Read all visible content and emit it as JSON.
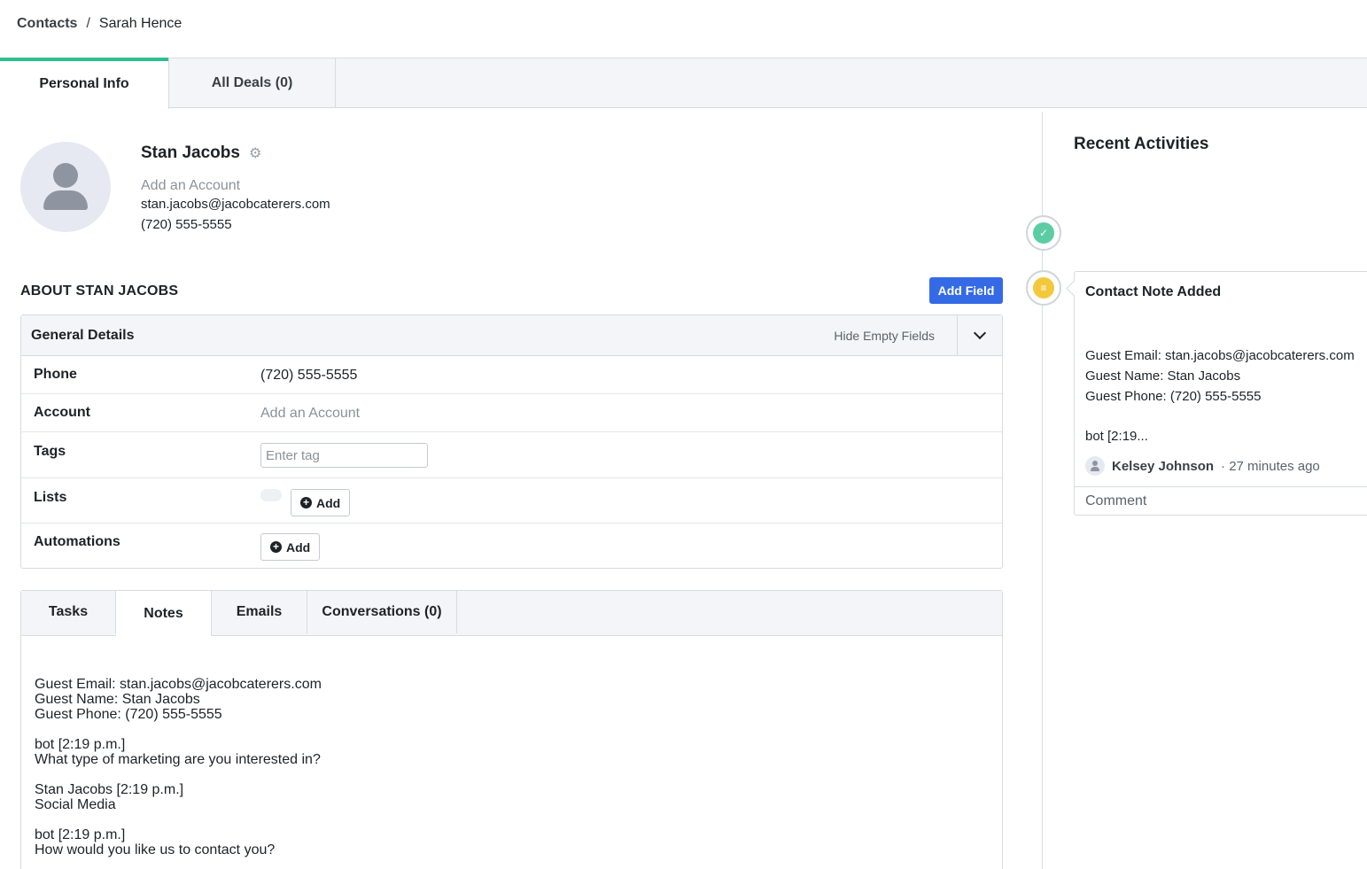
{
  "breadcrumb": {
    "parent": "Contacts",
    "separator": "/",
    "current": "Sarah Hence"
  },
  "top_tabs": {
    "personal": "Personal Info",
    "deals": "All Deals (0)"
  },
  "contact": {
    "name": "Stan Jacobs",
    "add_account": "Add an Account",
    "email": "stan.jacobs@jacobcaterers.com",
    "phone": "(720) 555-5555"
  },
  "about": {
    "title": "ABOUT STAN JACOBS",
    "add_field_label": "Add Field"
  },
  "general_details": {
    "title": "General Details",
    "hide_empty": "Hide Empty Fields",
    "phone_label": "Phone",
    "phone_value": "(720) 555-5555",
    "account_label": "Account",
    "account_value": "Add an Account",
    "tags_label": "Tags",
    "tags_placeholder": "Enter tag",
    "lists_label": "Lists",
    "lists_add": "Add",
    "automations_label": "Automations",
    "automations_add": "Add"
  },
  "activity_tabs": {
    "tasks": "Tasks",
    "notes": "Notes",
    "emails": "Emails",
    "conversations": "Conversations (0)"
  },
  "note": {
    "l1": "Guest Email: stan.jacobs@jacobcaterers.com",
    "l2": "Guest Name: Stan Jacobs",
    "l3": "Guest Phone: (720) 555-5555",
    "l4": "bot [2:19 p.m.]",
    "l5": "What type of marketing are you interested in?",
    "l6": "Stan Jacobs [2:19 p.m.]",
    "l7": "Social Media",
    "l8": "bot [2:19 p.m.]",
    "l9": "How would you like us to contact you?"
  },
  "recent": {
    "title": "Recent Activities",
    "card_title": "Contact Note Added",
    "card_l1": "Guest Email: stan.jacobs@jacobcaterers.com",
    "card_l2": "Guest Name: Stan Jacobs",
    "card_l3": "Guest Phone: (720) 555-5555",
    "card_l4": "bot [2:19...",
    "author": "Kelsey Johnson",
    "time": "· 27 minutes ago",
    "comment_placeholder": "Comment"
  },
  "colors": {
    "accent_tab": "#2dbf91",
    "primary_button": "#356ae6",
    "task_dot": "#5ccca4",
    "note_dot": "#f3c83c"
  }
}
